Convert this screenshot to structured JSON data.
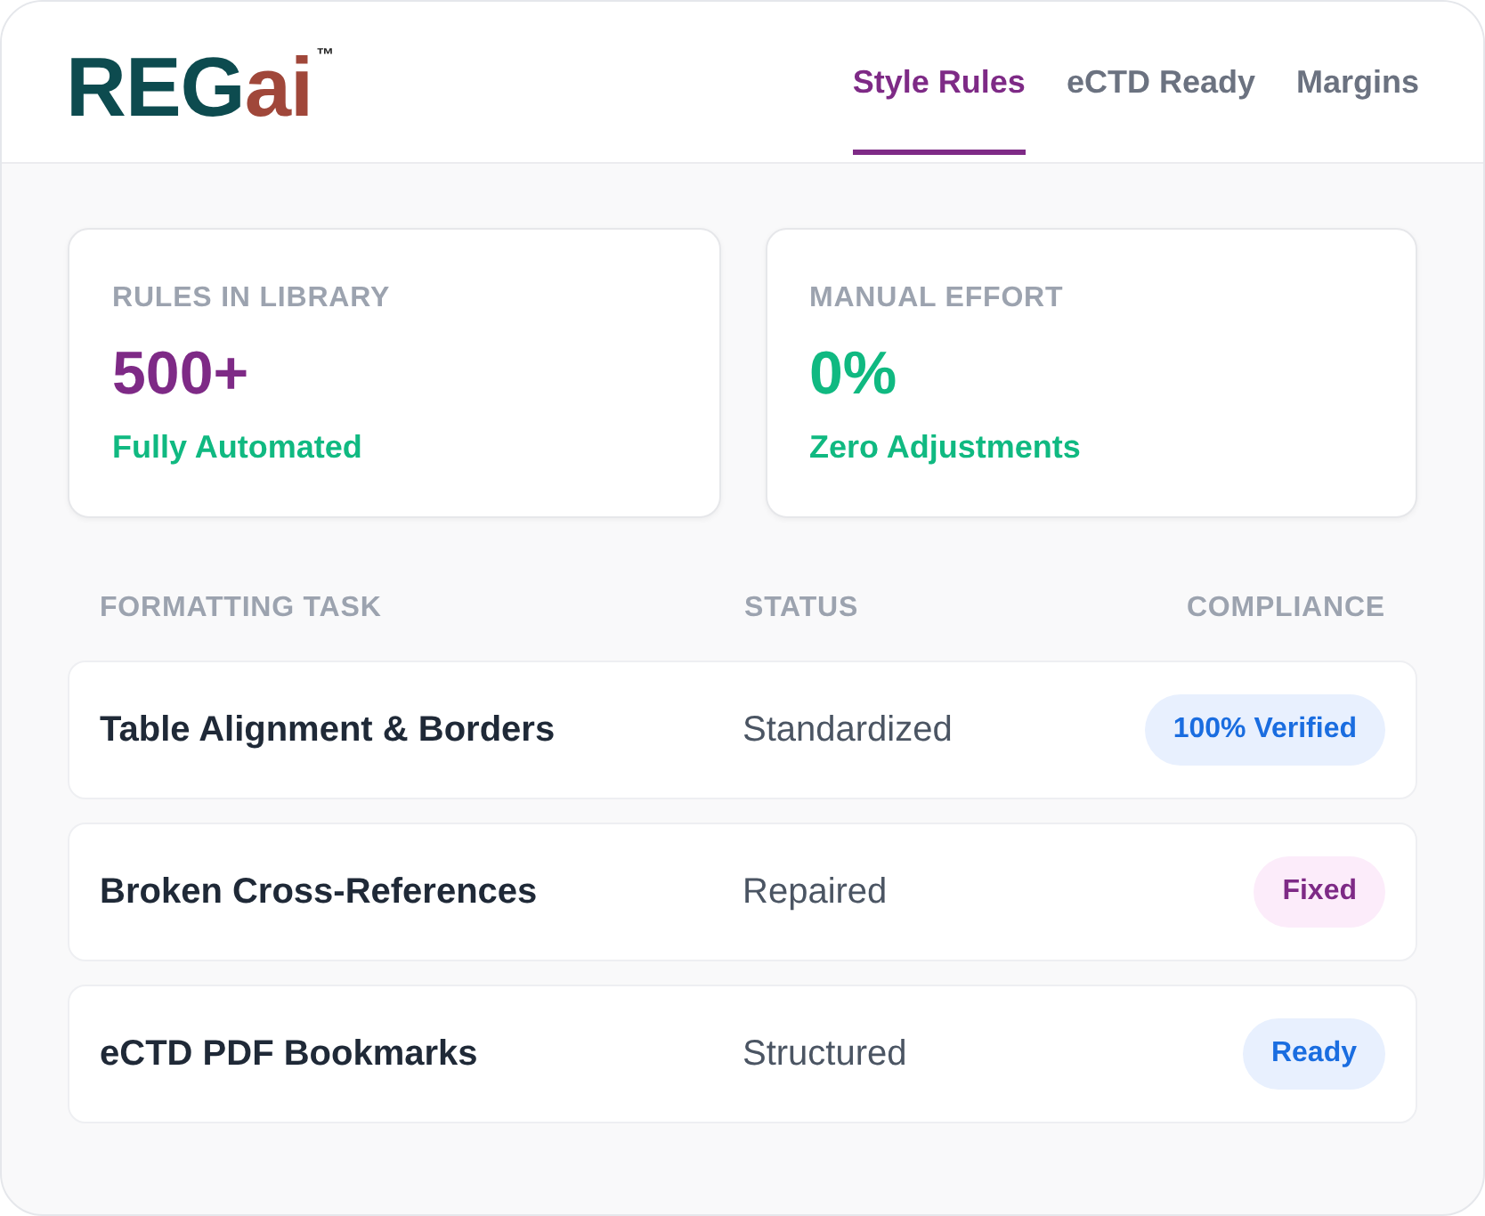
{
  "logo": {
    "primary": "REG",
    "accent": "ai",
    "mark": "™"
  },
  "tabs": [
    {
      "label": "Style Rules",
      "selected": true
    },
    {
      "label": "eCTD Ready",
      "selected": false
    },
    {
      "label": "Margins",
      "selected": false
    }
  ],
  "stats": [
    {
      "label": "RULES IN LIBRARY",
      "value": "500+",
      "note": "Fully Automated",
      "color": "#7e2a86"
    },
    {
      "label": "MANUAL EFFORT",
      "value": "0%",
      "note": "Zero Adjustments",
      "color": "#10b981"
    }
  ],
  "table": {
    "columns": [
      "FORMATTING TASK",
      "STATUS",
      "COMPLIANCE"
    ],
    "rows": [
      {
        "task": "Table Alignment & Borders",
        "status": "Standardized",
        "badge": {
          "label": "100% Verified",
          "kind": "info"
        }
      },
      {
        "task": "Broken Cross-References",
        "status": "Repaired",
        "badge": {
          "label": "Fixed",
          "kind": "accent"
        }
      },
      {
        "task": "eCTD PDF Bookmarks",
        "status": "Structured",
        "badge": {
          "label": "Ready",
          "kind": "info"
        }
      }
    ]
  }
}
